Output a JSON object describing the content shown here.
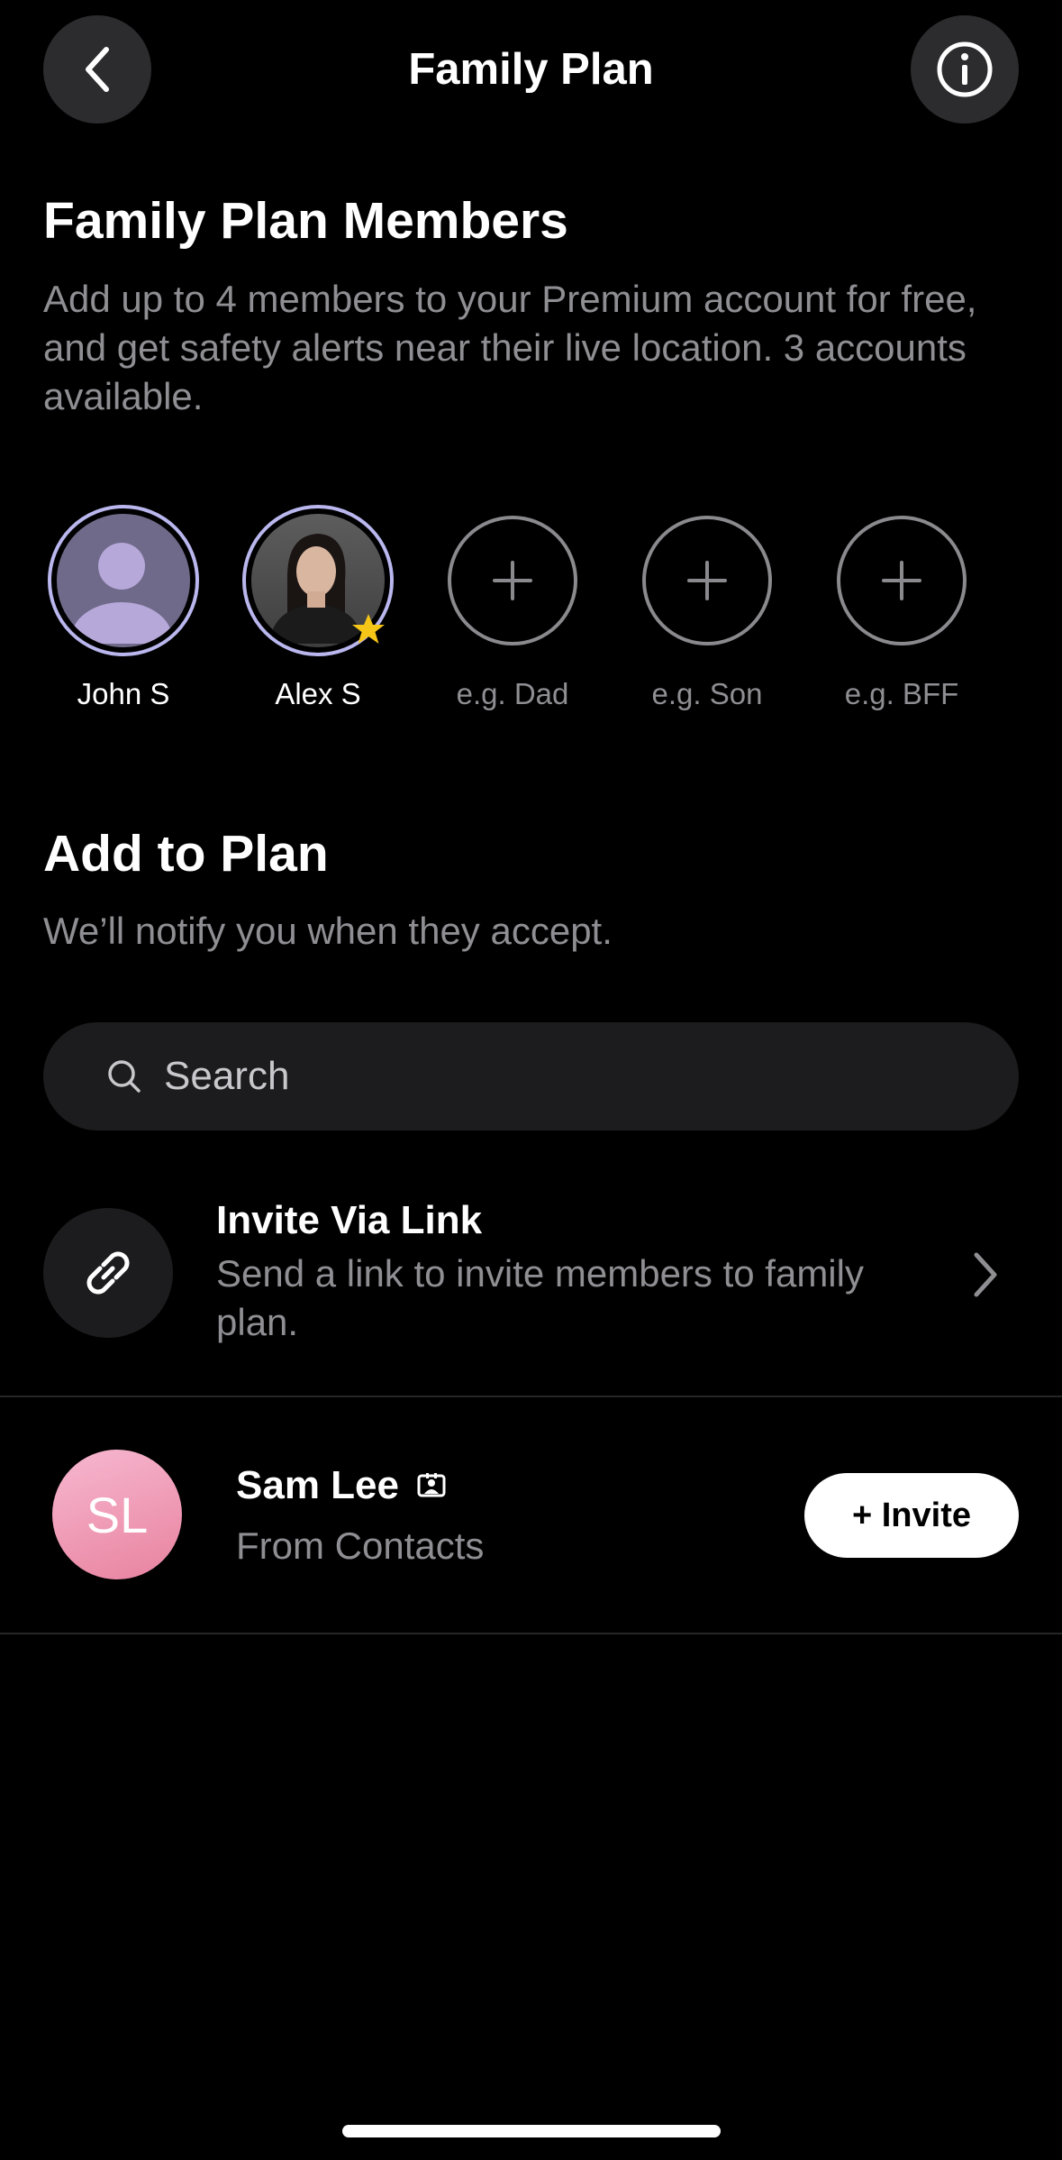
{
  "header": {
    "title": "Family Plan",
    "back_icon": "chevron-left-icon",
    "info_icon": "info-icon"
  },
  "members_section": {
    "title": "Family Plan Members",
    "description": "Add up to 4 members to your Premium account for free, and get safety alerts near their live location. 3 accounts available.",
    "members": [
      {
        "name": "John S",
        "type": "member",
        "avatar": "default-person-icon"
      },
      {
        "name": "Alex S",
        "type": "member",
        "avatar": "profile-photo",
        "badge": "star-icon"
      },
      {
        "name": "e.g. Dad",
        "type": "empty-slot"
      },
      {
        "name": "e.g. Son",
        "type": "empty-slot"
      },
      {
        "name": "e.g. BFF",
        "type": "empty-slot"
      }
    ]
  },
  "add_section": {
    "title": "Add to Plan",
    "description": "We’ll notify you when they accept."
  },
  "search": {
    "placeholder": "Search",
    "value": ""
  },
  "invite_link": {
    "title": "Invite Via Link",
    "description": "Send a link to invite members to family plan."
  },
  "contacts": [
    {
      "initials": "SL",
      "name": "Sam Lee",
      "source": "From Contacts",
      "action_label": "+ Invite"
    }
  ],
  "colors": {
    "background": "#000000",
    "surface": "#1c1c1e",
    "muted_text": "#8e8e93",
    "avatar_ring": "#b9b7ee",
    "contact_avatar": "#ee93b0",
    "star": "#f5c518"
  }
}
